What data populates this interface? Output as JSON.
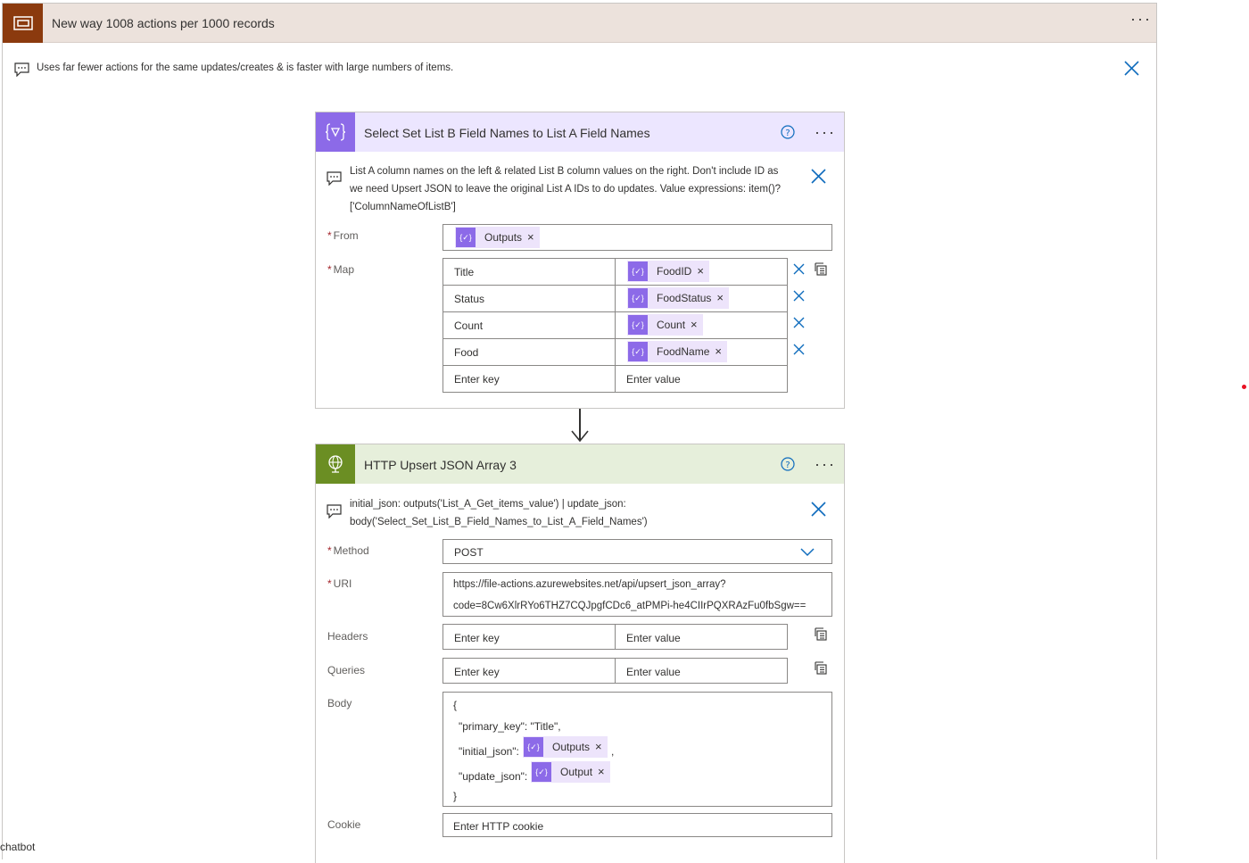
{
  "scope": {
    "title": "New way 1008 actions per 1000 records",
    "comment": "Uses far fewer actions for the same updates/creates & is faster with large numbers of items.",
    "brand_color": "#8b3a0e",
    "icon": "scope-icon"
  },
  "select_action": {
    "title": "Select Set List B Field Names to List A Field Names",
    "header_color": "#ece6ff",
    "icon_color": "#8c6ae8",
    "icon": "data-operation-icon",
    "comment_lines": [
      "List A column names on the left & related List B column values on the right. Don't include ID as",
      "we need Upsert JSON to leave the original List A IDs to do updates. Value expressions: item()?",
      "['ColumnNameOfListB']"
    ],
    "from_label": "From",
    "from_token": "Outputs",
    "map_label": "Map",
    "map_rows": [
      {
        "key": "Title",
        "value": "FoodID"
      },
      {
        "key": "Status",
        "value": "FoodStatus"
      },
      {
        "key": "Count",
        "value": "Count"
      },
      {
        "key": "Food",
        "value": "FoodName"
      }
    ],
    "key_placeholder": "Enter key",
    "value_placeholder": "Enter value"
  },
  "http_action": {
    "title": "HTTP Upsert JSON Array 3",
    "header_color": "#e6efdb",
    "icon_color": "#6b8e23",
    "icon": "globe-icon",
    "comment_lines": [
      "initial_json: outputs('List_A_Get_items_value') | update_json:",
      "body('Select_Set_List_B_Field_Names_to_List_A_Field_Names')"
    ],
    "method_label": "Method",
    "method_value": "POST",
    "uri_label": "URI",
    "uri_lines": [
      "https://file-actions.azurewebsites.net/api/upsert_json_array?",
      "code=8Cw6XlrRYo6THZ7CQJpgfCDc6_atPMPi-he4CIIrPQXRAzFu0fbSgw=="
    ],
    "headers_label": "Headers",
    "queries_label": "Queries",
    "key_placeholder": "Enter key",
    "value_placeholder": "Enter value",
    "body_label": "Body",
    "body_open": "{",
    "body_primary_key": "\"primary_key\": \"Title\",",
    "body_initial_key": "\"initial_json\":",
    "body_initial_token": "Outputs",
    "body_initial_comma": ",",
    "body_update_key": "\"update_json\":",
    "body_update_token": "Output",
    "body_close": "}",
    "cookie_label": "Cookie",
    "cookie_placeholder": "Enter HTTP cookie"
  },
  "footer": {
    "chatbot_text": "chatbot"
  },
  "token_remove": "×"
}
